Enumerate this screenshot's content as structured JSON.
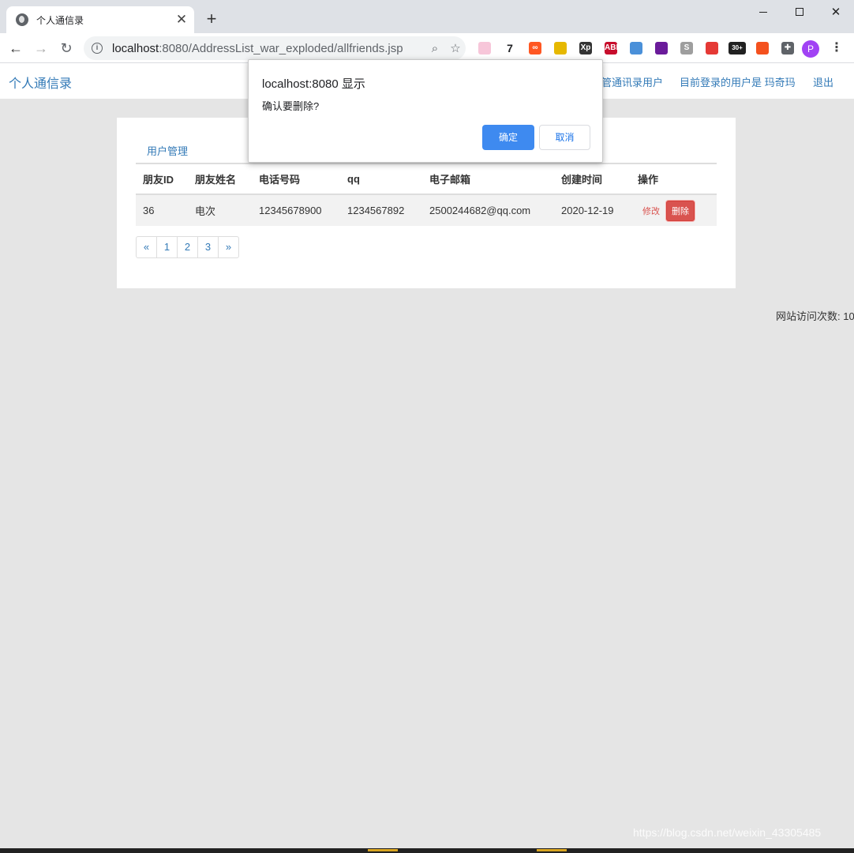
{
  "browser": {
    "tab_title": "个人通信录",
    "tab_close": "✕",
    "new_tab": "+",
    "url_host": "localhost",
    "url_path": ":8080/AddressList_war_exploded/allfriends.jsp",
    "extensions": [
      {
        "name": "ext-1-icon",
        "label": "",
        "color": "#f7c6d9"
      },
      {
        "name": "ext-7-icon",
        "label": "7",
        "color": "#ffffff"
      },
      {
        "name": "ext-infinity-icon",
        "label": "∞",
        "color": "#ff5722"
      },
      {
        "name": "ext-key-icon",
        "label": "",
        "color": "#e6b800"
      },
      {
        "name": "ext-xp-icon",
        "label": "Xp",
        "color": "#333333"
      },
      {
        "name": "ext-abp-icon",
        "label": "ABP",
        "color": "#c70d2c"
      },
      {
        "name": "ext-face-icon",
        "label": "",
        "color": "#4a90d9"
      },
      {
        "name": "ext-circle-icon",
        "label": "",
        "color": "#6a1b9a"
      },
      {
        "name": "ext-s-icon",
        "label": "S",
        "color": "#9e9e9e"
      },
      {
        "name": "ext-block-icon",
        "label": "",
        "color": "#e53935"
      },
      {
        "name": "ext-badge-icon",
        "label": "30+",
        "color": "#212121"
      },
      {
        "name": "ext-orange-icon",
        "label": "",
        "color": "#f4511e"
      },
      {
        "name": "ext-puzzle-icon",
        "label": "✚",
        "color": "#5f6368"
      }
    ],
    "profile_initial": "P"
  },
  "header": {
    "brand": "个人通信录",
    "manage_link": "管通讯录用户",
    "current_user": "目前登录的用户是 玛奇玛",
    "logout": "退出"
  },
  "panel": {
    "tab": "用户管理",
    "columns": [
      "朋友ID",
      "朋友姓名",
      "电话号码",
      "qq",
      "电子邮箱",
      "创建时间",
      "操作"
    ],
    "rows": [
      {
        "id": "36",
        "name": "电次",
        "phone": "12345678900",
        "qq": "1234567892",
        "email": "2500244682@qq.com",
        "created": "2020-12-19",
        "edit": "修改",
        "delete": "删除"
      }
    ],
    "pager": [
      "«",
      "1",
      "2",
      "3",
      "»"
    ]
  },
  "visit_count": "网站访问次数: 10",
  "dialog": {
    "title": "localhost:8080 显示",
    "message": "确认要删除?",
    "ok": "确定",
    "cancel": "取消"
  },
  "watermark": "https://blog.csdn.net/weixin_43305485"
}
